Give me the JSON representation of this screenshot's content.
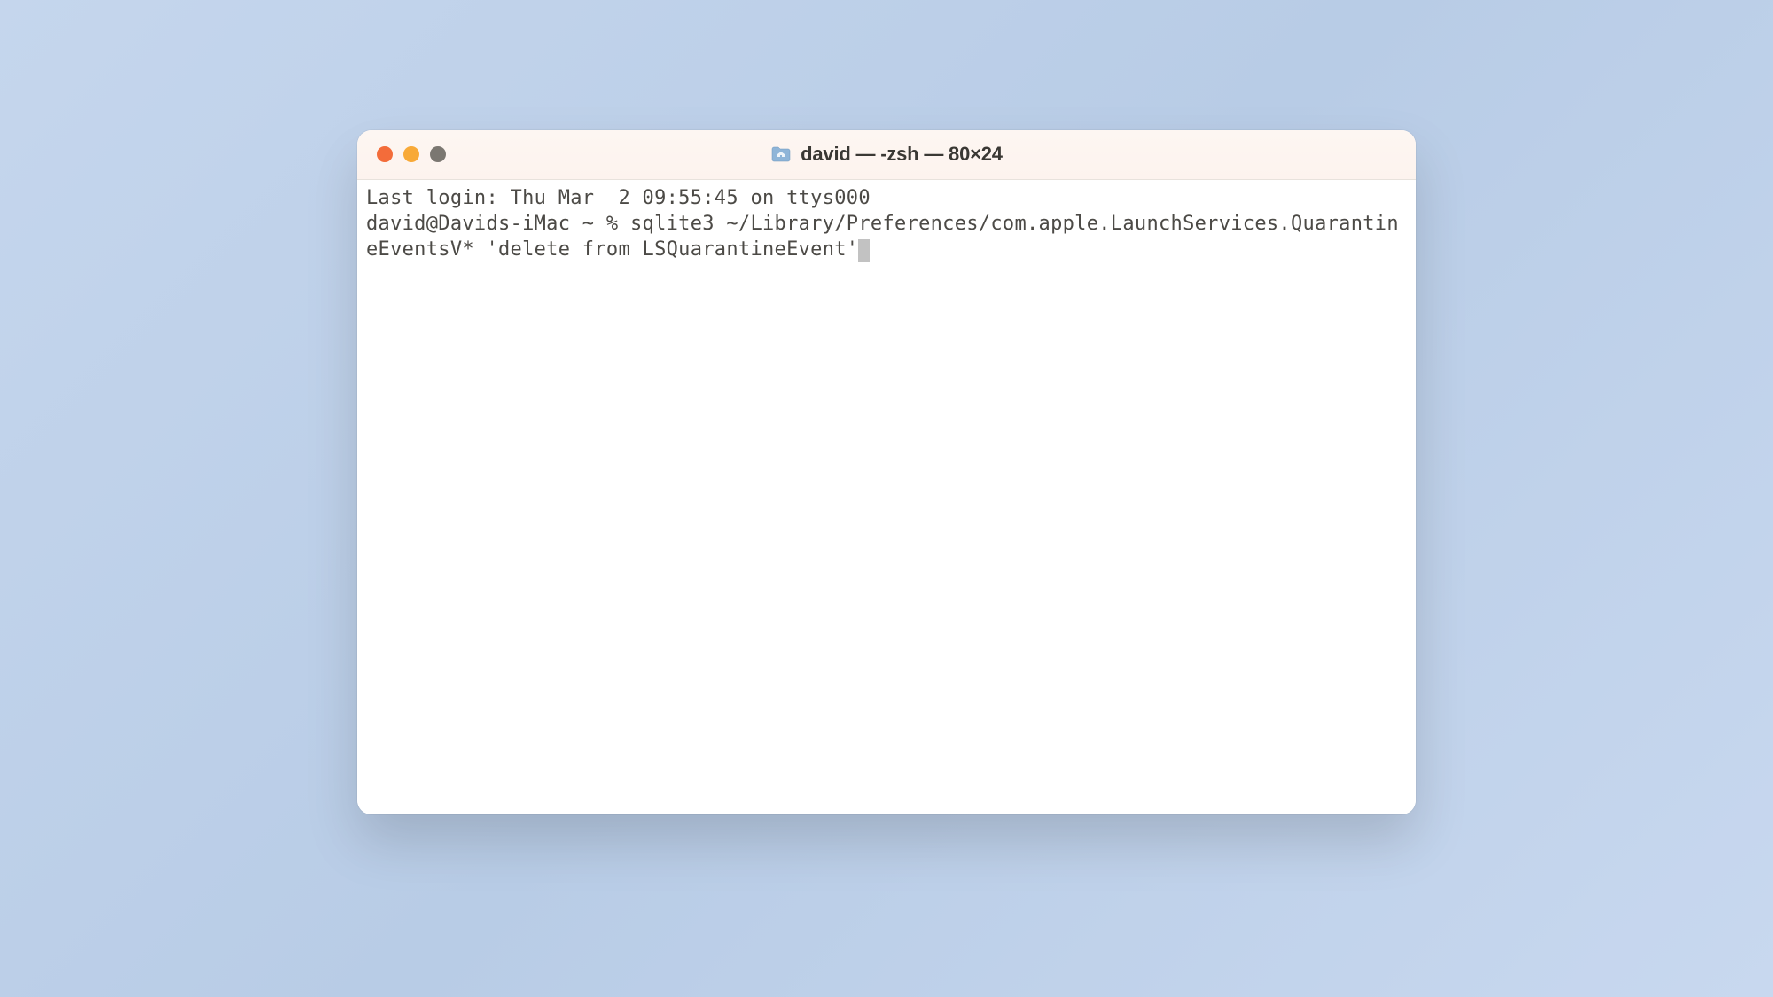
{
  "window": {
    "title": "david — -zsh — 80×24"
  },
  "terminal": {
    "last_login": "Last login: Thu Mar  2 09:55:45 on ttys000",
    "prompt": "david@Davids-iMac ~ % ",
    "command": "sqlite3 ~/Library/Preferences/com.apple.LaunchServices.QuarantineEventsV* 'delete from LSQuarantineEvent'"
  }
}
